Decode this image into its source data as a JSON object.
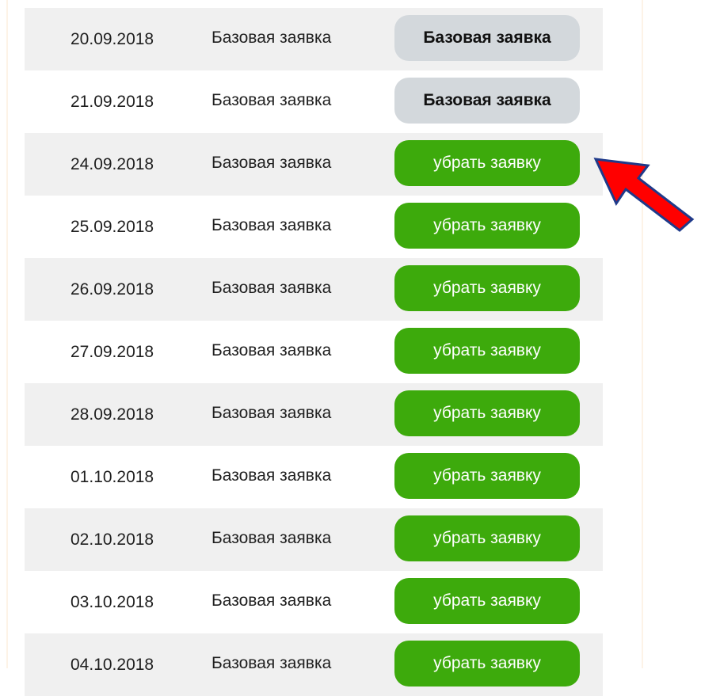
{
  "rows": [
    {
      "date": "20.09.2018",
      "type": "Базовая заявка",
      "action": "Базовая заявка",
      "state": "grey"
    },
    {
      "date": "21.09.2018",
      "type": "Базовая заявка",
      "action": "Базовая заявка",
      "state": "grey"
    },
    {
      "date": "24.09.2018",
      "type": "Базовая заявка",
      "action": "убрать заявку",
      "state": "green"
    },
    {
      "date": "25.09.2018",
      "type": "Базовая заявка",
      "action": "убрать заявку",
      "state": "green"
    },
    {
      "date": "26.09.2018",
      "type": "Базовая заявка",
      "action": "убрать заявку",
      "state": "green"
    },
    {
      "date": "27.09.2018",
      "type": "Базовая заявка",
      "action": "убрать заявку",
      "state": "green"
    },
    {
      "date": "28.09.2018",
      "type": "Базовая заявка",
      "action": "убрать заявку",
      "state": "green"
    },
    {
      "date": "01.10.2018",
      "type": "Базовая заявка",
      "action": "убрать заявку",
      "state": "green"
    },
    {
      "date": "02.10.2018",
      "type": "Базовая заявка",
      "action": "убрать заявку",
      "state": "green"
    },
    {
      "date": "03.10.2018",
      "type": "Базовая заявка",
      "action": "убрать заявку",
      "state": "green"
    },
    {
      "date": "04.10.2018",
      "type": "Базовая заявка",
      "action": "убрать заявку",
      "state": "green"
    }
  ],
  "colors": {
    "green_button": "#3daa0c",
    "grey_button": "#d3d8dc",
    "row_shade": "#f0f0f0",
    "annotation_arrow": "#ff0000"
  },
  "icons": {
    "annotation": "red-arrow-icon"
  }
}
